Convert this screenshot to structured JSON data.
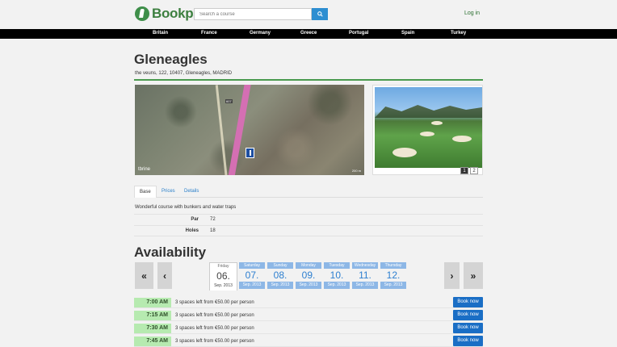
{
  "header": {
    "brand": "Bookpar",
    "search_placeholder": "Search a course",
    "login_label": "Log in"
  },
  "nav": [
    "Britain",
    "France",
    "Germany",
    "Greece",
    "Portugal",
    "Spain",
    "Turkey"
  ],
  "course": {
    "name": "Gleneagles",
    "address": "the veuns, 122, 10407, Gleneagles, MADRID"
  },
  "map": {
    "provider_label": "tbrine",
    "road_label": "607",
    "scale_label": "200 m"
  },
  "photo": {
    "pages": [
      "1",
      "2"
    ],
    "active_page": 1
  },
  "tabs": [
    "Base",
    "Prices",
    "Details"
  ],
  "base": {
    "description": "Wonderful course with bunkers and water traps",
    "rows": [
      {
        "key": "Par",
        "value": "72"
      },
      {
        "key": "Holes",
        "value": "18"
      }
    ]
  },
  "availability": {
    "title": "Availability",
    "days": [
      {
        "name": "Friday",
        "date": "06.",
        "month": "Sep. 2013",
        "selected": true
      },
      {
        "name": "Saturday",
        "date": "07.",
        "month": "Sep. 2013",
        "selected": false
      },
      {
        "name": "Sunday",
        "date": "08.",
        "month": "Sep. 2013",
        "selected": false
      },
      {
        "name": "Monday",
        "date": "09.",
        "month": "Sep. 2013",
        "selected": false
      },
      {
        "name": "Tuesday",
        "date": "10.",
        "month": "Sep. 2013",
        "selected": false
      },
      {
        "name": "Wednesday",
        "date": "11.",
        "month": "Sep. 2013",
        "selected": false
      },
      {
        "name": "Thursday",
        "date": "12.",
        "month": "Sep. 2013",
        "selected": false
      }
    ],
    "slots": [
      {
        "time": "7:00 AM",
        "spaces": "3 spaces left from €50.00 per person",
        "button": "Book now"
      },
      {
        "time": "7:15 AM",
        "spaces": "3 spaces left from €50.00 per person",
        "button": "Book now"
      },
      {
        "time": "7:30 AM",
        "spaces": "3 spaces left from €50.00 per person",
        "button": "Book now"
      },
      {
        "time": "7:45 AM",
        "spaces": "3 spaces left from €50.00 per person",
        "button": "Book now"
      }
    ]
  },
  "colors": {
    "brand_green": "#3c7f3f",
    "link_blue": "#2a7fc9",
    "book_button": "#1a6ec5",
    "time_badge": "#b6eab0",
    "day_badge": "#8db7e6"
  }
}
